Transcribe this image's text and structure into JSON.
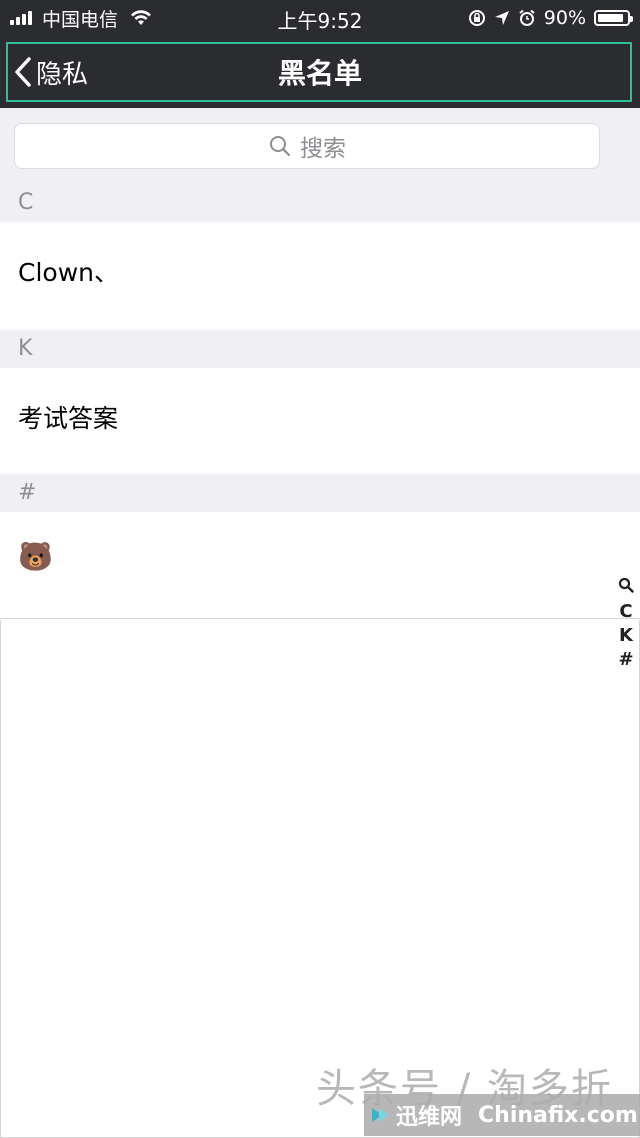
{
  "status_bar": {
    "carrier": "中国电信",
    "time": "上午9:52",
    "battery": "90%",
    "battery_level": 0.9,
    "icons": [
      "signal-icon",
      "wifi-icon",
      "orientation-lock-icon",
      "location-arrow-icon",
      "alarm-icon",
      "battery-icon"
    ]
  },
  "nav": {
    "back_label": "隐私",
    "title": "黑名单"
  },
  "search": {
    "placeholder": "搜索"
  },
  "sections": [
    {
      "header": "C",
      "items": [
        "Clown、"
      ]
    },
    {
      "header": "K",
      "items": [
        "考试答案"
      ]
    },
    {
      "header": "#",
      "items": [
        "🐻"
      ]
    }
  ],
  "index_bar": [
    "C",
    "K",
    "#"
  ],
  "watermark": {
    "line1": "头条号 / 淘多折",
    "brand_cn": "迅维网",
    "brand_en": "Chinafix.com"
  },
  "colors": {
    "bar_bg": "#2b2c30",
    "nav_outline": "#2fbf9a",
    "section_bg": "#efeff4",
    "muted_text": "#8e8e93"
  }
}
